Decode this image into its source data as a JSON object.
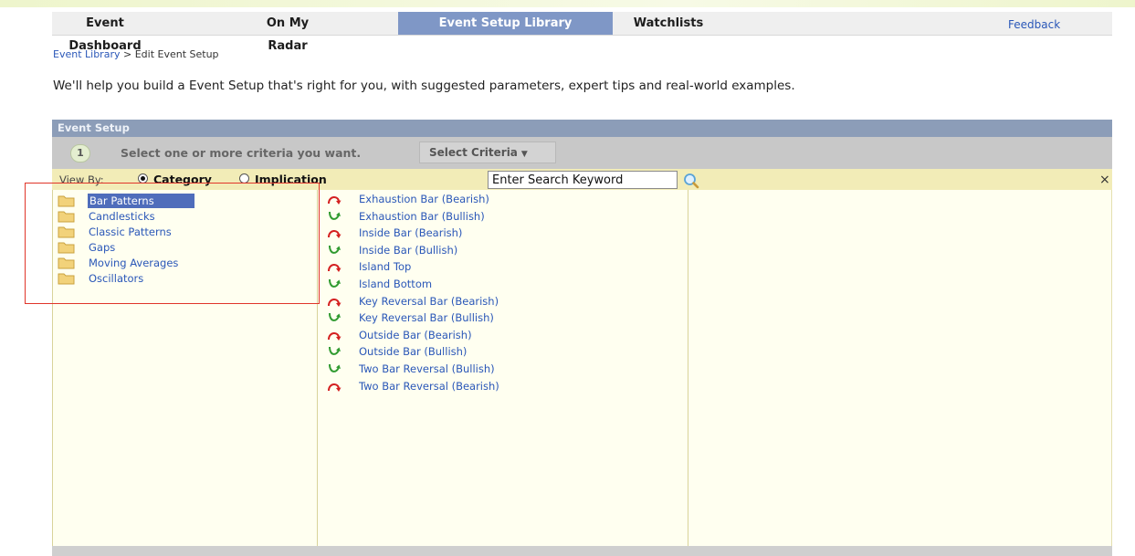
{
  "tabs": [
    {
      "label": "Event Dashboard",
      "active": false
    },
    {
      "label": "On My Radar",
      "active": false
    },
    {
      "label": "Event Setup Library",
      "active": true
    },
    {
      "label": "Watchlists",
      "active": false
    }
  ],
  "feedback_label": "Feedback",
  "breadcrumb": {
    "link": "Event Library",
    "separator": ">",
    "current": "Edit Event Setup"
  },
  "intro_text": "We'll help you build a Event Setup that's right for you, with suggested parameters, expert tips and real-world examples.",
  "panel": {
    "title": "Event Setup",
    "step": {
      "number": "1",
      "text": "Select one or more criteria you want.",
      "button_label": "Select Criteria"
    },
    "view_by": {
      "label": "View By:",
      "options": [
        {
          "label": "Category",
          "checked": true
        },
        {
          "label": "Implication",
          "checked": false
        }
      ]
    },
    "search": {
      "value": "Enter Search Keyword"
    },
    "close_label": "×"
  },
  "categories": [
    {
      "label": "Bar Patterns",
      "selected": true
    },
    {
      "label": "Candlesticks",
      "selected": false
    },
    {
      "label": "Classic Patterns",
      "selected": false
    },
    {
      "label": "Gaps",
      "selected": false
    },
    {
      "label": "Moving Averages",
      "selected": false
    },
    {
      "label": "Oscillators",
      "selected": false
    }
  ],
  "events": [
    {
      "label": "Exhaustion Bar (Bearish)",
      "icon": "bearish-arrow-icon"
    },
    {
      "label": "Exhaustion Bar (Bullish)",
      "icon": "bullish-arrow-icon"
    },
    {
      "label": "Inside Bar (Bearish)",
      "icon": "bearish-arrow-icon"
    },
    {
      "label": "Inside Bar (Bullish)",
      "icon": "bullish-arrow-icon"
    },
    {
      "label": "Island Top",
      "icon": "bearish-arrow-icon"
    },
    {
      "label": "Island Bottom",
      "icon": "bullish-arrow-icon"
    },
    {
      "label": "Key Reversal Bar (Bearish)",
      "icon": "bearish-arrow-icon"
    },
    {
      "label": "Key Reversal Bar (Bullish)",
      "icon": "bullish-arrow-icon"
    },
    {
      "label": "Outside Bar (Bearish)",
      "icon": "bearish-arrow-icon"
    },
    {
      "label": "Outside Bar (Bullish)",
      "icon": "bullish-arrow-icon"
    },
    {
      "label": "Two Bar Reversal (Bullish)",
      "icon": "bullish-arrow-icon"
    },
    {
      "label": "Two Bar Reversal (Bearish)",
      "icon": "bearish-arrow-icon"
    }
  ],
  "colors": {
    "active_tab": "#7f97c6",
    "link": "#2a57b8",
    "bearish": "#d42020",
    "bullish": "#2f9a2f",
    "highlight_box": "#e0352a"
  }
}
